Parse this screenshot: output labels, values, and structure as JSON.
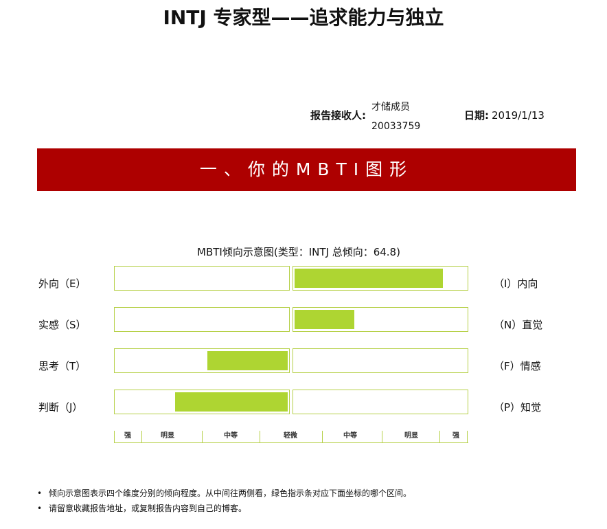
{
  "header": {
    "title": "INTJ 专家型——追求能力与独立",
    "receiver_label": "报告接收人:",
    "receiver_name": "才储成员",
    "receiver_id": "20033759",
    "date_label": "日期:",
    "date_value": "2019/1/13"
  },
  "section": {
    "banner": "一、你的MBTI图形"
  },
  "chart_data": {
    "type": "bar",
    "title": "MBTI倾向示意图(类型：INTJ 总倾向：64.8)",
    "rows": [
      {
        "left": "外向（E）",
        "right": "（I）内向",
        "side": "right",
        "value": 0.87
      },
      {
        "left": "实感（S）",
        "right": "（N）直觉",
        "side": "right",
        "value": 0.35
      },
      {
        "left": "思考（T）",
        "right": "（F）情感",
        "side": "left",
        "value": 0.47
      },
      {
        "left": "判断（J）",
        "right": "（P）知觉",
        "side": "left",
        "value": 0.66
      }
    ],
    "scale_labels": [
      "强",
      "明显",
      "中等",
      "轻微",
      "中等",
      "明显",
      "强"
    ]
  },
  "notes": [
    "倾向示意图表示四个维度分别的倾向程度。从中间往两侧看，绿色指示条对应下面坐标的哪个区间。",
    "请留意收藏报告地址，或复制报告内容到自己的博客。"
  ],
  "colors": {
    "banner": "#ad0000",
    "bar": "#aed532",
    "border": "#b5d046"
  }
}
